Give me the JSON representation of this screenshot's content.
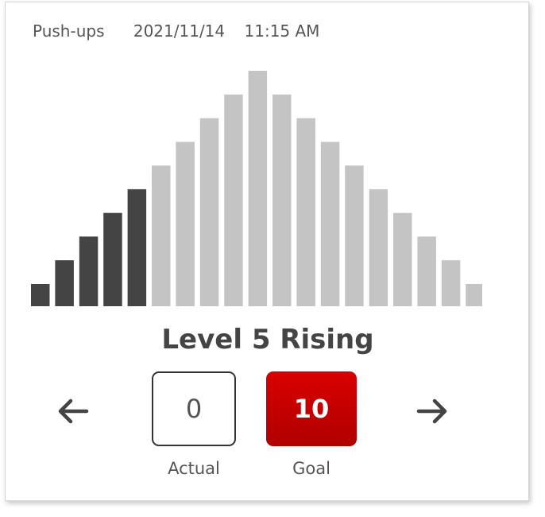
{
  "header": {
    "exercise": "Push-ups",
    "date": "2021/11/14",
    "time": "11:15 AM"
  },
  "level_title": "Level 5 Rising",
  "actual": {
    "value": "0",
    "label": "Actual"
  },
  "goal": {
    "value": "10",
    "label": "Goal"
  },
  "navigation": {
    "prev_icon": "arrow-left-icon",
    "next_icon": "arrow-right-icon"
  },
  "chart_data": {
    "type": "bar",
    "values": [
      1,
      2,
      3,
      4,
      5,
      6,
      7,
      8,
      9,
      10,
      9,
      8,
      7,
      6,
      5,
      4,
      3,
      2,
      1
    ],
    "completed_count": 5,
    "ylim": [
      0,
      10
    ],
    "completed_color": "#444444",
    "remaining_color": "#c4c4c4"
  },
  "colors": {
    "goal_bg": "#cc0000",
    "text": "#444444"
  }
}
